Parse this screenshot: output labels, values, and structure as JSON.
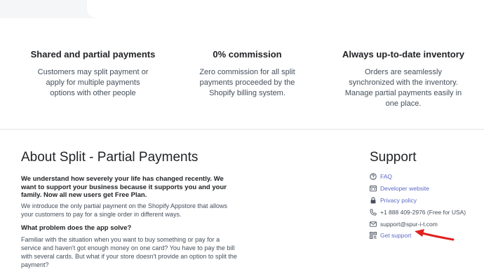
{
  "features": [
    {
      "title": "Shared and partial payments",
      "text_lines": [
        "Customers may split payment or",
        "apply for multiple payments",
        "options with other people"
      ]
    },
    {
      "title": "0% commission",
      "text_lines": [
        "Zero commission for all split",
        "payments proceeded by the",
        "Shopify billing system."
      ]
    },
    {
      "title": "Always up-to-date inventory",
      "text_lines": [
        "Orders are seamlessly",
        "synchronized with the inventory.",
        "Manage partial payments easily in",
        "one place."
      ]
    }
  ],
  "about": {
    "title": "About Split - Partial Payments",
    "intro": "We understand how severely your life has changed recently. We want to support your business because it supports you and your family. Now all new users get Free Plan.",
    "paragraph": "We introduce the only partial payment on the Shopify Appstore that allows your customers to pay for a single order in different ways.",
    "question": "What problem does the app solve?",
    "paragraph2": "Familiar with the situation when you want to buy something or pay for a service and haven't got enough money on one card? You have to pay the bill with several cards. But what if your store doesn't provide an option to split the payment?"
  },
  "support": {
    "title": "Support",
    "items": [
      {
        "icon": "question-circle-icon",
        "label": "FAQ",
        "link": true
      },
      {
        "icon": "code-window-icon",
        "label": "Developer website",
        "link": true
      },
      {
        "icon": "lock-icon",
        "label": "Privacy policy",
        "link": true
      },
      {
        "icon": "phone-icon",
        "label": "+1 888 409-2976 (Free for USA)",
        "link": false
      },
      {
        "icon": "mail-icon",
        "label": "support@spur-i-t.com",
        "link": false
      },
      {
        "icon": "qr-code-icon",
        "label": "Get support",
        "link": true
      }
    ]
  },
  "colors": {
    "link": "#5c6ac4",
    "arrow": "#e02020"
  }
}
